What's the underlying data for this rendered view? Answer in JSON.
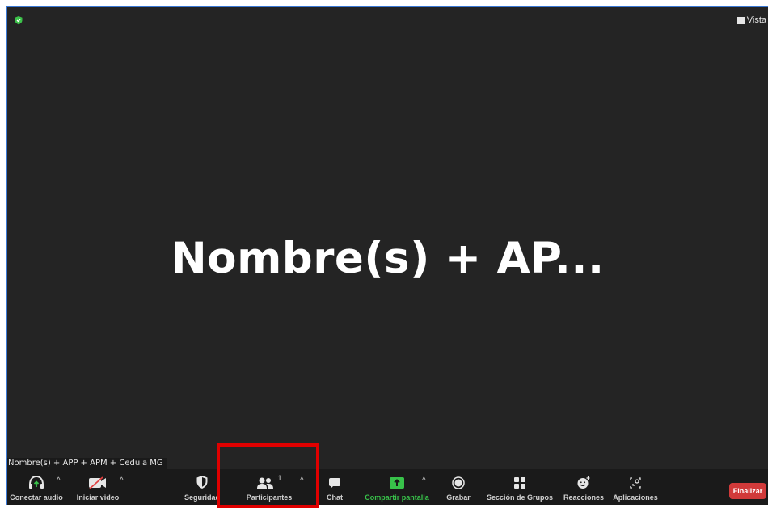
{
  "meeting": {
    "display_name": "Nombre(s)  +  AP...",
    "participant_name_tag": "Nombre(s) + APP + APM + Cedula MG",
    "view_label": "Vista"
  },
  "toolbar": {
    "audio": "Conectar audio",
    "video": "Iniciar video",
    "security": "Seguridad",
    "participants": "Participantes",
    "participants_count": "1",
    "chat": "Chat",
    "share": "Compartir pantalla",
    "record": "Grabar",
    "breakout": "Sección de Grupos",
    "reactions": "Reacciones",
    "apps": "Aplicaciones",
    "end": "Finalizar",
    "caret": "^"
  },
  "colors": {
    "background": "#242424",
    "toolbar": "#1a1a1a",
    "share_green": "#38c24a",
    "end_red": "#d13a3a",
    "highlight_red": "#e00000",
    "shield_green": "#3cc24a"
  }
}
